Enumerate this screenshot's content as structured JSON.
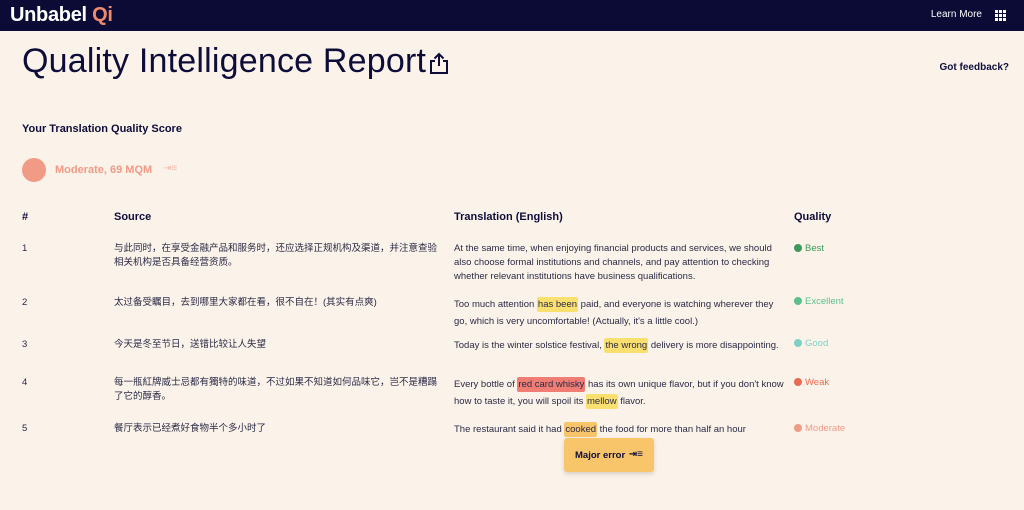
{
  "header": {
    "logo_main": "Unbabel",
    "logo_accent": "Qi",
    "learn_more": "Learn More",
    "menu_icon": "grid-icon"
  },
  "page": {
    "title": "Quality Intelligence Report",
    "share_icon": "share-icon",
    "feedback": "Got feedback?"
  },
  "score": {
    "heading": "Your Translation Quality Score",
    "label": "Moderate, 69 MQM",
    "expand_icon": "expand-icon",
    "color": "#f19a86"
  },
  "table": {
    "columns": [
      "#",
      "Source",
      "Translation (English)",
      "Quality"
    ],
    "rows": [
      {
        "num": "1",
        "source": "与此同时，在享受金融产品和服务时，还应选择正规机构及渠道，并注意查验相关机构是否具备经营资质。",
        "translation": [
          {
            "t": "At the same time, when enjoying financial products and services, we should also choose formal institutions and channels, and pay attention to checking whether relevant institutions have business qualifications.",
            "h": ""
          }
        ],
        "quality": "Best",
        "color": "#3b9a5a"
      },
      {
        "num": "2",
        "source": "太过备受瞩目，去到哪里大家都在看，很不自在！(其实有点爽)",
        "translation": [
          {
            "t": "Too much attention ",
            "h": ""
          },
          {
            "t": "has been",
            "h": "y"
          },
          {
            "t": " paid, and everyone is watching wherever they go, which is very uncomfortable! (Actually, it's a little cool.)",
            "h": ""
          }
        ],
        "quality": "Excellent",
        "color": "#5cc08a"
      },
      {
        "num": "3",
        "source": "今天是冬至节日，送错比较让人失望",
        "translation": [
          {
            "t": "Today is the winter solstice festival, ",
            "h": ""
          },
          {
            "t": "the wrong",
            "h": "y"
          },
          {
            "t": " delivery is more disappointing.",
            "h": ""
          }
        ],
        "quality": "Good",
        "color": "#7fd0c4"
      },
      {
        "num": "4",
        "source": "每一瓶紅牌威士忌都有獨特的味道，不过如果不知道如何品味它，岂不是糟蹋了它的醇香。",
        "translation": [
          {
            "t": "Every bottle of ",
            "h": ""
          },
          {
            "t": "red card whisky",
            "h": "r"
          },
          {
            "t": " has its own unique flavor, but if you don't know how to taste it, you will spoil its ",
            "h": ""
          },
          {
            "t": "mellow",
            "h": "y"
          },
          {
            "t": " flavor.",
            "h": ""
          }
        ],
        "quality": "Weak",
        "color": "#ea6a4f"
      },
      {
        "num": "5",
        "source": "餐厅表示已经煮好食物半个多小时了",
        "translation": [
          {
            "t": "The restaurant said it had ",
            "h": ""
          },
          {
            "t": "cooked",
            "h": "o"
          },
          {
            "t": " the food for more than half an hour",
            "h": ""
          }
        ],
        "quality": "Moderate",
        "color": "#f19a86"
      }
    ]
  },
  "tooltip": {
    "label": "Major error",
    "icon": "expand-icon"
  }
}
